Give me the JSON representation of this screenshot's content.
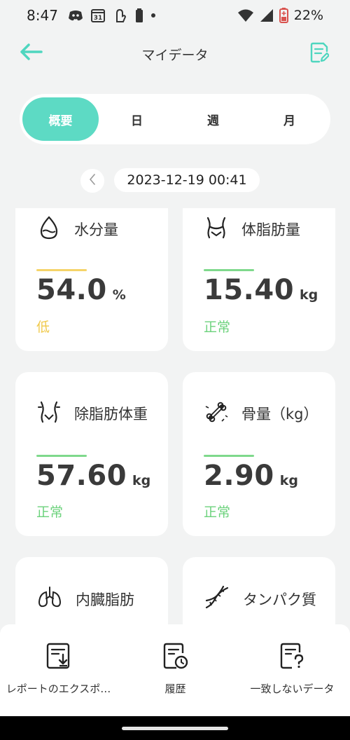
{
  "status_bar": {
    "time": "8:47",
    "calendar_day": "31",
    "battery_percent": "22%",
    "icons": [
      "discord-icon",
      "calendar-icon",
      "accessibility-icon",
      "battery-small-icon",
      "dot-icon",
      "wifi-icon",
      "signal-icon",
      "battery-saver-icon"
    ]
  },
  "header": {
    "title": "マイデータ",
    "back_icon": "arrow-left-icon",
    "report_icon": "document-edit-icon"
  },
  "tabs": [
    {
      "label": "概要",
      "active": true
    },
    {
      "label": "日",
      "active": false
    },
    {
      "label": "週",
      "active": false
    },
    {
      "label": "月",
      "active": false
    }
  ],
  "date": {
    "value": "2023-12-19 00:41",
    "prev_icon": "chevron-left-icon"
  },
  "cards": [
    {
      "title": "水分量",
      "icon": "water-drop-icon",
      "value": "54.0",
      "unit": "%",
      "status": "低",
      "status_color": "#f0c94a",
      "bar_color": "#f5d469"
    },
    {
      "title": "体脂肪量",
      "icon": "body-fat-icon",
      "value": "15.40",
      "unit": "kg",
      "status": "正常",
      "status_color": "#6cd27c",
      "bar_color": "#7fd98c"
    },
    {
      "title": "除脂肪体重",
      "icon": "lean-body-icon",
      "value": "57.60",
      "unit": "kg",
      "status": "正常",
      "status_color": "#6cd27c",
      "bar_color": "#7fd98c"
    },
    {
      "title": "骨量（kg）",
      "icon": "bone-icon",
      "value": "2.90",
      "unit": "kg",
      "status": "正常",
      "status_color": "#6cd27c",
      "bar_color": "#7fd98c"
    },
    {
      "title": "内臓脂肪",
      "icon": "lungs-icon"
    },
    {
      "title": "タンパク質",
      "icon": "dna-icon"
    }
  ],
  "bottom_actions": [
    {
      "label": "レポートのエクスポ…",
      "icon": "export-report-icon"
    },
    {
      "label": "履歴",
      "icon": "history-icon"
    },
    {
      "label": "一致しないデータ",
      "icon": "unmatched-data-icon"
    }
  ],
  "colors": {
    "accent": "#5ddac4",
    "background": "#f2f3f3",
    "low": "#f0c94a",
    "normal": "#6cd27c"
  }
}
